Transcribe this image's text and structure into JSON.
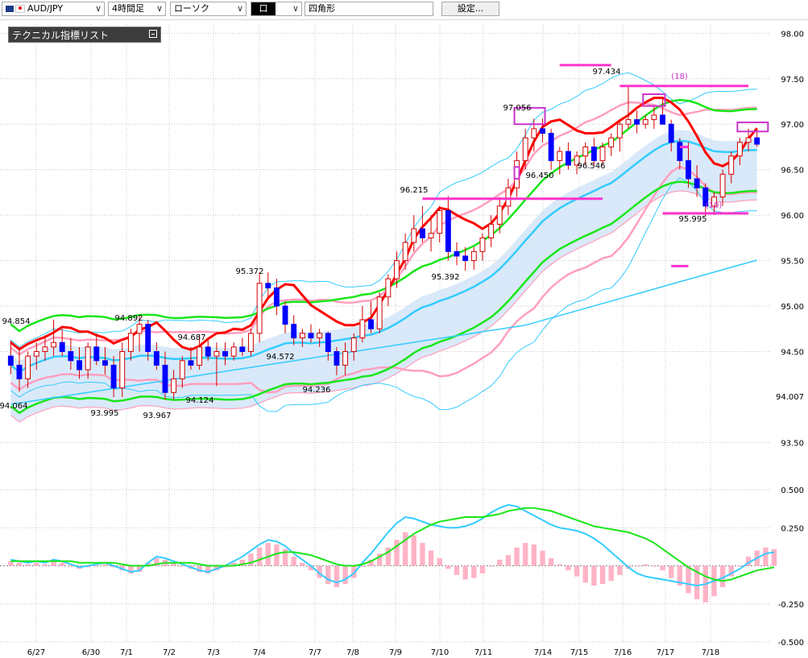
{
  "toolbar": {
    "symbol": "AUD/JPY",
    "timeframe": "4時間足",
    "chart_style": "ローソク",
    "draw_tool": "四角形",
    "settings_label": "設定..."
  },
  "indicator_panel": {
    "title": "テクニカル指標リスト"
  },
  "colors": {
    "candle_up": "#ffffff",
    "candle_down": "#0000ff",
    "wick": "#d40000",
    "sma_fast": "#ff0000",
    "bb_mid": "#19e619",
    "bb_outer": "#ff9fbf",
    "envelope": "#33ccff",
    "long_ma": "#33ccff",
    "cloud": "#cfe4f7",
    "macd_bar": "#ffb3c6",
    "macd_line": "#33ccff",
    "signal_line": "#19e619",
    "marker": "#ff33cc",
    "box": "#cc33cc"
  },
  "chart_data": [
    {
      "type": "candlestick",
      "title": "",
      "ylim": [
        93.3,
        98.1
      ],
      "y_ticks": [
        "98.00",
        "97.50",
        "97.00",
        "96.50",
        "96.00",
        "95.50",
        "95.00",
        "94.50",
        "94.007",
        "93.50"
      ],
      "y_tick_values": [
        98.0,
        97.5,
        97.0,
        96.5,
        96.0,
        95.5,
        95.0,
        94.5,
        94.007,
        93.5
      ],
      "x_labels": [
        "6/27",
        "6/30",
        "7/1",
        "7/2",
        "7/3",
        "7/4",
        "7/7",
        "7/8",
        "7/9",
        "7/10",
        "7/11",
        "7/14",
        "7/15",
        "7/16",
        "7/17",
        "7/18"
      ],
      "candles": [
        {
          "o": 94.45,
          "h": 94.62,
          "l": 94.25,
          "c": 94.35
        },
        {
          "o": 94.35,
          "h": 94.55,
          "l": 94.06,
          "c": 94.2
        },
        {
          "o": 94.2,
          "h": 94.5,
          "l": 94.1,
          "c": 94.45
        },
        {
          "o": 94.45,
          "h": 94.6,
          "l": 94.3,
          "c": 94.5
        },
        {
          "o": 94.5,
          "h": 94.68,
          "l": 94.4,
          "c": 94.55
        },
        {
          "o": 94.55,
          "h": 94.85,
          "l": 94.45,
          "c": 94.6
        },
        {
          "o": 94.6,
          "h": 94.75,
          "l": 94.45,
          "c": 94.5
        },
        {
          "o": 94.5,
          "h": 94.65,
          "l": 94.3,
          "c": 94.4
        },
        {
          "o": 94.4,
          "h": 94.55,
          "l": 94.2,
          "c": 94.3
        },
        {
          "o": 94.3,
          "h": 94.6,
          "l": 94.2,
          "c": 94.55
        },
        {
          "o": 94.55,
          "h": 94.7,
          "l": 94.35,
          "c": 94.4
        },
        {
          "o": 94.4,
          "h": 94.55,
          "l": 94.25,
          "c": 94.35
        },
        {
          "o": 94.35,
          "h": 94.45,
          "l": 94.0,
          "c": 94.1
        },
        {
          "o": 94.1,
          "h": 94.6,
          "l": 94.0,
          "c": 94.5
        },
        {
          "o": 94.5,
          "h": 94.75,
          "l": 94.4,
          "c": 94.7
        },
        {
          "o": 94.7,
          "h": 94.89,
          "l": 94.5,
          "c": 94.8
        },
        {
          "o": 94.8,
          "h": 94.85,
          "l": 94.4,
          "c": 94.5
        },
        {
          "o": 94.5,
          "h": 94.6,
          "l": 94.3,
          "c": 94.35
        },
        {
          "o": 94.35,
          "h": 94.5,
          "l": 93.97,
          "c": 94.05
        },
        {
          "o": 94.05,
          "h": 94.3,
          "l": 93.97,
          "c": 94.2
        },
        {
          "o": 94.2,
          "h": 94.45,
          "l": 94.1,
          "c": 94.4
        },
        {
          "o": 94.4,
          "h": 94.55,
          "l": 94.3,
          "c": 94.35
        },
        {
          "o": 94.35,
          "h": 94.69,
          "l": 94.3,
          "c": 94.55
        },
        {
          "o": 94.55,
          "h": 94.65,
          "l": 94.4,
          "c": 94.45
        },
        {
          "o": 94.45,
          "h": 94.6,
          "l": 94.12,
          "c": 94.5
        },
        {
          "o": 94.5,
          "h": 94.6,
          "l": 94.35,
          "c": 94.45
        },
        {
          "o": 94.45,
          "h": 94.6,
          "l": 94.4,
          "c": 94.55
        },
        {
          "o": 94.55,
          "h": 94.65,
          "l": 94.45,
          "c": 94.5
        },
        {
          "o": 94.5,
          "h": 94.75,
          "l": 94.45,
          "c": 94.7
        },
        {
          "o": 94.7,
          "h": 95.37,
          "l": 94.6,
          "c": 95.25
        },
        {
          "o": 95.25,
          "h": 95.37,
          "l": 95.1,
          "c": 95.2
        },
        {
          "o": 95.2,
          "h": 95.3,
          "l": 94.9,
          "c": 95.0
        },
        {
          "o": 95.0,
          "h": 95.05,
          "l": 94.7,
          "c": 94.8
        },
        {
          "o": 94.8,
          "h": 94.9,
          "l": 94.57,
          "c": 94.65
        },
        {
          "o": 94.65,
          "h": 94.75,
          "l": 94.55,
          "c": 94.7
        },
        {
          "o": 94.7,
          "h": 94.8,
          "l": 94.6,
          "c": 94.65
        },
        {
          "o": 94.65,
          "h": 94.75,
          "l": 94.55,
          "c": 94.7
        },
        {
          "o": 94.7,
          "h": 94.72,
          "l": 94.4,
          "c": 94.5
        },
        {
          "o": 94.5,
          "h": 94.55,
          "l": 94.24,
          "c": 94.35
        },
        {
          "o": 94.35,
          "h": 94.6,
          "l": 94.24,
          "c": 94.5
        },
        {
          "o": 94.5,
          "h": 94.7,
          "l": 94.4,
          "c": 94.65
        },
        {
          "o": 94.65,
          "h": 95.0,
          "l": 94.6,
          "c": 94.85
        },
        {
          "o": 94.85,
          "h": 95.05,
          "l": 94.7,
          "c": 94.75
        },
        {
          "o": 94.75,
          "h": 95.15,
          "l": 94.7,
          "c": 95.1
        },
        {
          "o": 95.1,
          "h": 95.35,
          "l": 95.0,
          "c": 95.3
        },
        {
          "o": 95.3,
          "h": 95.6,
          "l": 95.2,
          "c": 95.5
        },
        {
          "o": 95.5,
          "h": 95.8,
          "l": 95.4,
          "c": 95.7
        },
        {
          "o": 95.7,
          "h": 96.0,
          "l": 95.6,
          "c": 95.85
        },
        {
          "o": 95.85,
          "h": 96.1,
          "l": 95.7,
          "c": 95.75
        },
        {
          "o": 95.75,
          "h": 96.0,
          "l": 95.6,
          "c": 95.8
        },
        {
          "o": 95.8,
          "h": 96.1,
          "l": 95.7,
          "c": 96.05
        },
        {
          "o": 96.05,
          "h": 96.21,
          "l": 95.5,
          "c": 95.6
        },
        {
          "o": 95.6,
          "h": 95.7,
          "l": 95.45,
          "c": 95.55
        },
        {
          "o": 95.55,
          "h": 95.65,
          "l": 95.39,
          "c": 95.5
        },
        {
          "o": 95.5,
          "h": 95.65,
          "l": 95.4,
          "c": 95.6
        },
        {
          "o": 95.6,
          "h": 95.8,
          "l": 95.5,
          "c": 95.75
        },
        {
          "o": 95.75,
          "h": 96.0,
          "l": 95.65,
          "c": 95.9
        },
        {
          "o": 95.9,
          "h": 96.2,
          "l": 95.8,
          "c": 96.1
        },
        {
          "o": 96.1,
          "h": 96.4,
          "l": 96.0,
          "c": 96.3
        },
        {
          "o": 96.3,
          "h": 96.7,
          "l": 96.2,
          "c": 96.6
        },
        {
          "o": 96.6,
          "h": 96.95,
          "l": 96.5,
          "c": 96.85
        },
        {
          "o": 96.85,
          "h": 97.06,
          "l": 96.7,
          "c": 96.95
        },
        {
          "o": 96.95,
          "h": 97.06,
          "l": 96.8,
          "c": 96.9
        },
        {
          "o": 96.9,
          "h": 96.95,
          "l": 96.5,
          "c": 96.6
        },
        {
          "o": 96.6,
          "h": 96.75,
          "l": 96.45,
          "c": 96.7
        },
        {
          "o": 96.7,
          "h": 96.8,
          "l": 96.5,
          "c": 96.55
        },
        {
          "o": 96.55,
          "h": 96.7,
          "l": 96.45,
          "c": 96.65
        },
        {
          "o": 96.65,
          "h": 96.8,
          "l": 96.55,
          "c": 96.75
        },
        {
          "o": 96.75,
          "h": 96.85,
          "l": 96.55,
          "c": 96.6
        },
        {
          "o": 96.6,
          "h": 96.8,
          "l": 96.55,
          "c": 96.75
        },
        {
          "o": 96.75,
          "h": 96.9,
          "l": 96.65,
          "c": 96.85
        },
        {
          "o": 96.85,
          "h": 97.05,
          "l": 96.7,
          "c": 97.0
        },
        {
          "o": 97.0,
          "h": 97.43,
          "l": 96.95,
          "c": 97.05
        },
        {
          "o": 97.05,
          "h": 97.15,
          "l": 96.9,
          "c": 97.0
        },
        {
          "o": 97.0,
          "h": 97.1,
          "l": 96.95,
          "c": 97.05
        },
        {
          "o": 97.05,
          "h": 97.2,
          "l": 96.95,
          "c": 97.1
        },
        {
          "o": 97.1,
          "h": 97.3,
          "l": 97.0,
          "c": 97.0
        },
        {
          "o": 97.0,
          "h": 97.05,
          "l": 96.7,
          "c": 96.8
        },
        {
          "o": 96.8,
          "h": 96.85,
          "l": 96.5,
          "c": 96.6
        },
        {
          "o": 96.6,
          "h": 96.8,
          "l": 96.3,
          "c": 96.4
        },
        {
          "o": 96.4,
          "h": 96.55,
          "l": 96.2,
          "c": 96.3
        },
        {
          "o": 96.3,
          "h": 96.35,
          "l": 95.99,
          "c": 96.1
        },
        {
          "o": 96.1,
          "h": 96.25,
          "l": 96.0,
          "c": 96.2
        },
        {
          "o": 96.2,
          "h": 96.5,
          "l": 96.1,
          "c": 96.45
        },
        {
          "o": 96.45,
          "h": 96.7,
          "l": 96.35,
          "c": 96.65
        },
        {
          "o": 96.65,
          "h": 96.85,
          "l": 96.55,
          "c": 96.8
        },
        {
          "o": 96.8,
          "h": 96.95,
          "l": 96.7,
          "c": 96.85
        },
        {
          "o": 96.85,
          "h": 96.95,
          "l": 96.75,
          "c": 96.78
        }
      ],
      "price_labels": [
        {
          "text": "94.854",
          "value": 94.854
        },
        {
          "text": "94.064",
          "value": 94.064
        },
        {
          "text": "93.995",
          "value": 93.995
        },
        {
          "text": "94.892",
          "value": 94.892
        },
        {
          "text": "93.967",
          "value": 93.967
        },
        {
          "text": "94.687",
          "value": 94.687
        },
        {
          "text": "94.124",
          "value": 94.124
        },
        {
          "text": "95.372",
          "value": 95.372
        },
        {
          "text": "94.572",
          "value": 94.572
        },
        {
          "text": "94.236",
          "value": 94.236
        },
        {
          "text": "96.215",
          "value": 96.215
        },
        {
          "text": "95.392",
          "value": 95.392
        },
        {
          "text": "97.056",
          "value": 97.056
        },
        {
          "text": "96.450",
          "value": 96.45
        },
        {
          "text": "96.546",
          "value": 96.546
        },
        {
          "text": "97.434",
          "value": 97.434
        },
        {
          "text": "95.995",
          "value": 95.995
        }
      ],
      "annotations": [
        "(18)",
        "(10)"
      ]
    },
    {
      "type": "macd",
      "ylim": [
        -0.5,
        0.5
      ],
      "y_ticks": [
        "0.500",
        "0.250",
        "-0.250",
        "-0.500"
      ],
      "y_tick_values": [
        0.5,
        0.25,
        -0.25,
        -0.5
      ],
      "histogram": [
        0.03,
        0.02,
        0.01,
        0.02,
        0.01,
        0.03,
        0.02,
        0.0,
        -0.02,
        -0.01,
        0.0,
        0.01,
        -0.01,
        -0.03,
        -0.05,
        -0.04,
        0.02,
        0.05,
        0.04,
        0.02,
        0.0,
        -0.02,
        -0.04,
        -0.05,
        -0.03,
        -0.01,
        0.02,
        0.04,
        0.08,
        0.12,
        0.15,
        0.14,
        0.11,
        0.06,
        0.02,
        -0.03,
        -0.08,
        -0.12,
        -0.14,
        -0.12,
        -0.08,
        0.0,
        0.04,
        0.08,
        0.12,
        0.17,
        0.22,
        0.2,
        0.15,
        0.1,
        0.05,
        -0.02,
        -0.06,
        -0.09,
        -0.08,
        -0.05,
        0.0,
        0.04,
        0.07,
        0.12,
        0.15,
        0.14,
        0.1,
        0.05,
        0.01,
        -0.03,
        -0.07,
        -0.11,
        -0.13,
        -0.12,
        -0.1,
        -0.06,
        -0.02,
        0.0,
        0.01,
        0.0,
        -0.03,
        -0.08,
        -0.13,
        -0.18,
        -0.22,
        -0.24,
        -0.2,
        -0.14,
        -0.07,
        0.0,
        0.06,
        0.1,
        0.12,
        0.11
      ],
      "macd": [
        0.04,
        0.03,
        0.02,
        0.03,
        0.02,
        0.04,
        0.03,
        0.01,
        -0.01,
        0.0,
        0.01,
        0.02,
        0.0,
        -0.02,
        -0.04,
        -0.03,
        0.02,
        0.06,
        0.05,
        0.03,
        0.01,
        -0.01,
        -0.03,
        -0.04,
        -0.02,
        0.0,
        0.03,
        0.06,
        0.1,
        0.14,
        0.17,
        0.16,
        0.13,
        0.08,
        0.04,
        0.0,
        -0.05,
        -0.09,
        -0.11,
        -0.09,
        -0.05,
        0.02,
        0.08,
        0.15,
        0.22,
        0.28,
        0.32,
        0.31,
        0.29,
        0.27,
        0.26,
        0.25,
        0.25,
        0.26,
        0.28,
        0.31,
        0.35,
        0.38,
        0.4,
        0.39,
        0.36,
        0.33,
        0.3,
        0.27,
        0.25,
        0.24,
        0.23,
        0.21,
        0.18,
        0.14,
        0.09,
        0.04,
        -0.01,
        -0.05,
        -0.07,
        -0.08,
        -0.09,
        -0.1,
        -0.11,
        -0.12,
        -0.13,
        -0.12,
        -0.1,
        -0.08,
        -0.05,
        -0.02,
        0.02,
        0.05,
        0.08,
        0.09
      ],
      "signal": [
        0.03,
        0.03,
        0.03,
        0.03,
        0.03,
        0.03,
        0.03,
        0.03,
        0.02,
        0.02,
        0.02,
        0.02,
        0.02,
        0.01,
        0.0,
        0.0,
        0.0,
        0.01,
        0.02,
        0.02,
        0.02,
        0.02,
        0.01,
        0.0,
        0.0,
        0.0,
        0.0,
        0.01,
        0.02,
        0.04,
        0.06,
        0.08,
        0.09,
        0.09,
        0.08,
        0.07,
        0.05,
        0.03,
        0.01,
        0.0,
        0.0,
        0.01,
        0.03,
        0.06,
        0.09,
        0.13,
        0.17,
        0.21,
        0.24,
        0.27,
        0.29,
        0.3,
        0.31,
        0.32,
        0.32,
        0.32,
        0.33,
        0.34,
        0.36,
        0.37,
        0.38,
        0.38,
        0.37,
        0.36,
        0.34,
        0.32,
        0.3,
        0.28,
        0.26,
        0.25,
        0.24,
        0.23,
        0.22,
        0.2,
        0.18,
        0.15,
        0.11,
        0.07,
        0.03,
        -0.01,
        -0.04,
        -0.07,
        -0.09,
        -0.1,
        -0.09,
        -0.07,
        -0.05,
        -0.03,
        -0.02,
        -0.01
      ]
    }
  ]
}
